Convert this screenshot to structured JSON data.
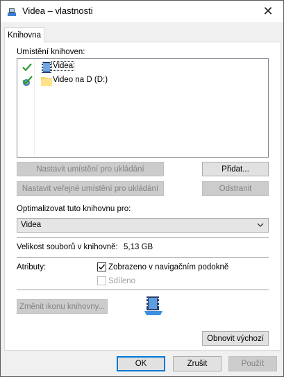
{
  "window": {
    "title": "Videa – vlastnosti",
    "close_glyph": "✕"
  },
  "tabs": [
    {
      "label": "Knihovna",
      "selected": true
    }
  ],
  "library_locations": {
    "label": "Umístění knihoven:",
    "items": [
      {
        "name": "Videa",
        "icon": "video-library-icon",
        "status_icon": "check-icon",
        "selected": true
      },
      {
        "name": "Video na D (D:)",
        "icon": "folder-icon",
        "status_icon": "public-save-check-icon",
        "selected": false
      }
    ]
  },
  "buttons": {
    "set_save_location": "Nastavit umístění pro ukládání",
    "add": "Přidat...",
    "set_public_save_location": "Nastavit veřejné umístění pro ukládání",
    "remove": "Odstranit",
    "change_icon": "Změnit ikonu knihovny...",
    "restore_defaults": "Obnovit výchozí",
    "ok": "OK",
    "cancel": "Zrušit",
    "apply": "Použít"
  },
  "optimize": {
    "label": "Optimalizovat tuto knihovnu pro:",
    "selected": "Videa"
  },
  "size": {
    "label": "Velikost souborů v knihovně:",
    "value": "5,13 GB"
  },
  "attributes": {
    "label": "Atributy:",
    "shown_in_nav": {
      "label": "Zobrazeno v navigačním podokně",
      "checked": true,
      "enabled": true
    },
    "shared": {
      "label": "Sdíleno",
      "checked": false,
      "enabled": false
    }
  },
  "colors": {
    "accent": "#0078d7",
    "check_green": "#2e9b2e"
  }
}
